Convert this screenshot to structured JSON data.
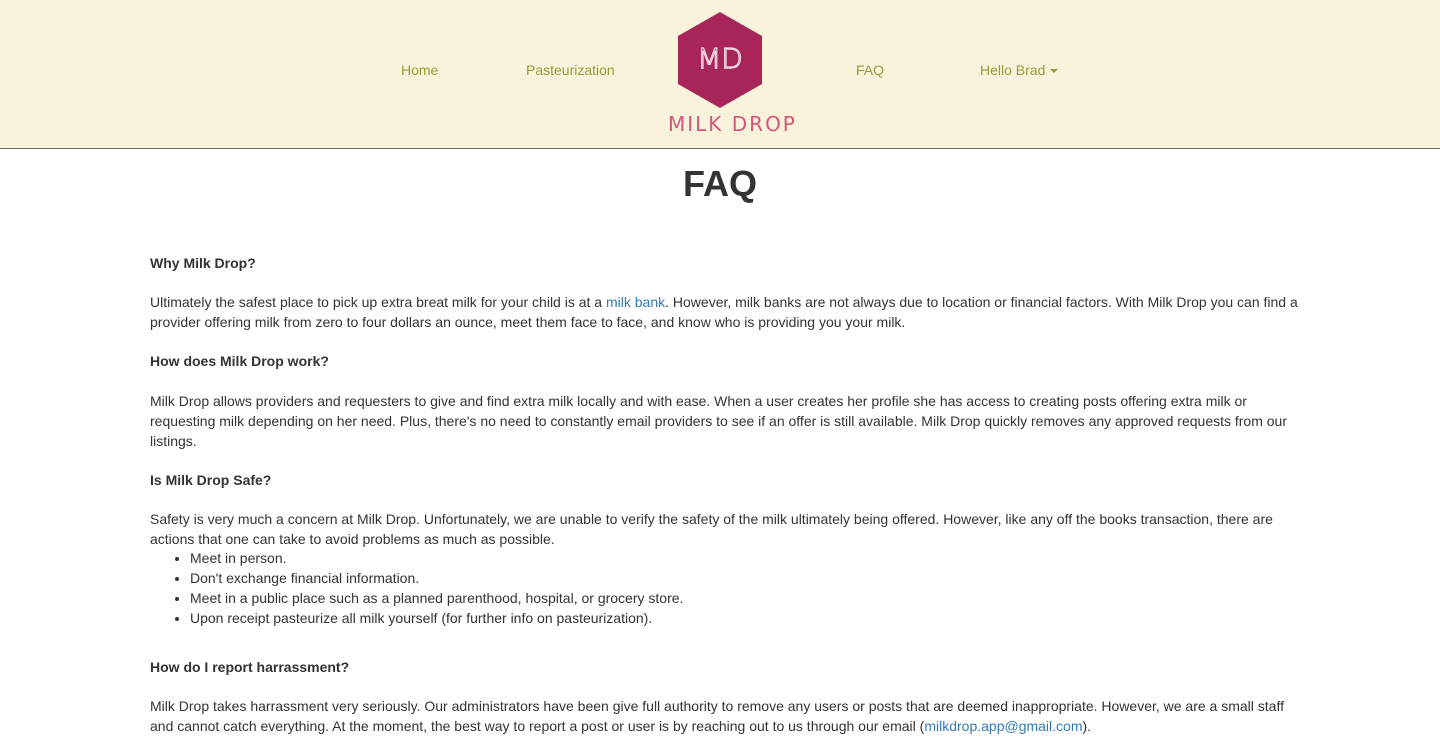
{
  "nav": {
    "home": "Home",
    "pasteurization": "Pasteurization",
    "faq": "FAQ",
    "user_menu": "Hello Brad",
    "logo_monogram": "MD",
    "logo_text": "MILK DROP"
  },
  "colors": {
    "nav_background": "#f8f3da",
    "nav_link": "#9b9a3e",
    "logo_hexagon": "#a8255a",
    "logo_text": "#d6557d",
    "link": "#337ab7"
  },
  "page": {
    "title": "FAQ"
  },
  "faq": {
    "q1": "Why Milk Drop?",
    "a1_before": "Ultimately the safest place to pick up extra breat milk for your child is at a ",
    "a1_link": "milk bank",
    "a1_after": ". However, milk banks are not always due to location or financial factors. With Milk Drop you can find a provider offering milk from zero to four dollars an ounce, meet them face to face, and know who is providing you your milk.",
    "q2": "How does Milk Drop work?",
    "a2": "Milk Drop allows providers and requesters to give and find extra milk locally and with ease. When a user creates her profile she has access to creating posts offering extra milk or requesting milk depending on her need. Plus, there's no need to constantly email providers to see if an offer is still available. Milk Drop quickly removes any approved requests from our listings.",
    "q3": "Is Milk Drop Safe?",
    "a3": "Safety is very much a concern at Milk Drop. Unfortunately, we are unable to verify the safety of the milk ultimately being offered. However, like any off the books transaction, there are actions that one can take to avoid problems as much as possible.",
    "tips": [
      "Meet in person.",
      "Don't exchange financial information.",
      "Meet in a public place such as a planned parenthood, hospital, or grocery store.",
      "Upon receipt pasteurize all milk yourself (for further info on pasteurization)."
    ],
    "q4": "How do I report harrassment?",
    "a4_before": "Milk Drop takes harrassment very seriously. Our administrators have been give full authority to remove any users or posts that are deemed inappropriate. However, we are a small staff and cannot catch everything. At the moment, the best way to report a post or user is by reaching out to us through our email (",
    "a4_link": "milkdrop.app@gmail.com",
    "a4_after": ")."
  }
}
